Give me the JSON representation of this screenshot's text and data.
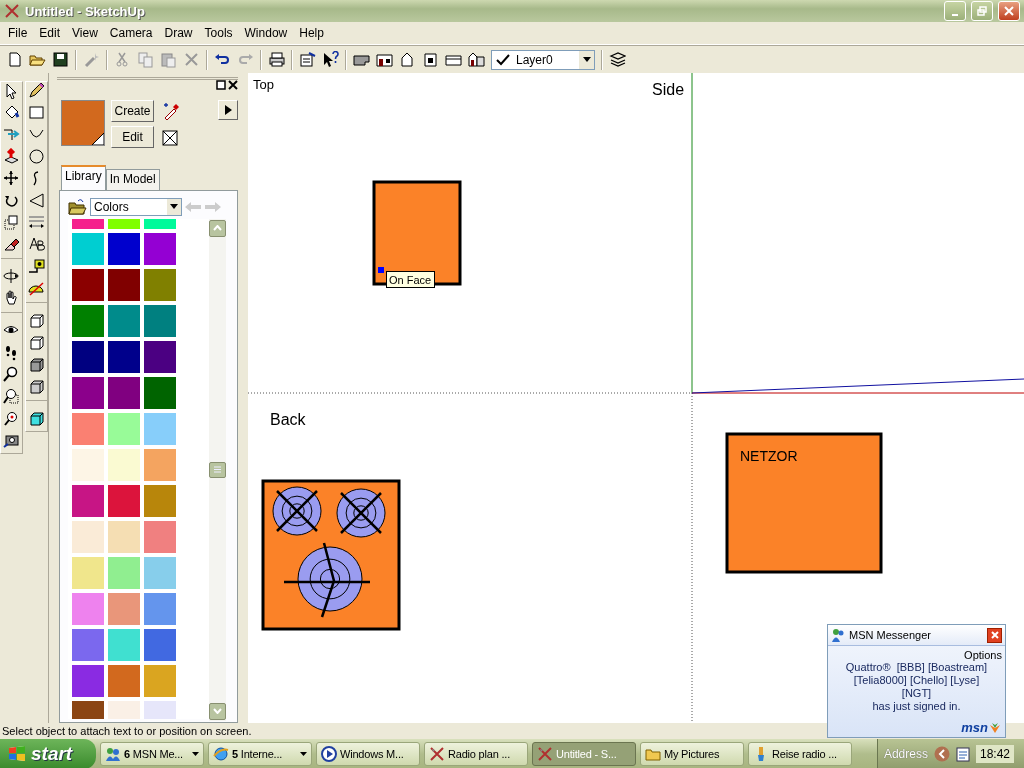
{
  "window": {
    "title": "Untitled - SketchUp"
  },
  "menu": [
    "File",
    "Edit",
    "View",
    "Camera",
    "Draw",
    "Tools",
    "Window",
    "Help"
  ],
  "layer_dropdown": {
    "value": "Layer0"
  },
  "materials": {
    "buttons": [
      "Create",
      "Edit"
    ],
    "tabs": [
      {
        "label": "Library",
        "selected": true
      },
      {
        "label": "In Model",
        "selected": false
      }
    ],
    "library": {
      "value": "Colors"
    },
    "swatch_rows": [
      [
        {
          "color": "#f5208c"
        },
        {
          "color": "#80ff00"
        },
        {
          "color": "#00fa9a"
        }
      ],
      [
        {
          "color": "#00ced1"
        },
        {
          "color": "#0000cd"
        },
        {
          "color": "#9400d3"
        }
      ],
      [
        {
          "color": "#8b0000"
        },
        {
          "color": "#800000"
        },
        {
          "color": "#808000"
        }
      ],
      [
        {
          "color": "#008000"
        },
        {
          "color": "#008b8b"
        },
        {
          "color": "#008080"
        }
      ],
      [
        {
          "color": "#000080"
        },
        {
          "color": "#00008b"
        },
        {
          "color": "#4b0082"
        }
      ],
      [
        {
          "color": "#8b008b"
        },
        {
          "color": "#800080"
        },
        {
          "color": "#006400"
        }
      ],
      [
        {
          "color": "#fa8072"
        },
        {
          "color": "#98fb98"
        },
        {
          "color": "#87cefa"
        }
      ],
      [
        {
          "color": "#fdf5e6"
        },
        {
          "color": "#fafad2"
        },
        {
          "color": "#f4a460"
        }
      ],
      [
        {
          "color": "#c71585"
        },
        {
          "color": "#dc143c"
        },
        {
          "color": "#b8860b"
        }
      ],
      [
        {
          "color": "#faebd7"
        },
        {
          "color": "#f5deb3"
        },
        {
          "color": "#f08080"
        }
      ],
      [
        {
          "color": "#f0e68c"
        },
        {
          "color": "#90ee90"
        },
        {
          "color": "#87ceeb"
        }
      ],
      [
        {
          "color": "#ee82ee"
        },
        {
          "color": "#e9967a"
        },
        {
          "color": "#6495ed"
        }
      ],
      [
        {
          "color": "#7b68ee"
        },
        {
          "color": "#40e0d0"
        },
        {
          "color": "#4169e1"
        }
      ],
      [
        {
          "color": "#8a2be2"
        },
        {
          "color": "#d2691e"
        },
        {
          "color": "#daa520"
        }
      ],
      [
        {
          "color": "#8b4513"
        },
        {
          "color": "#faf0e6"
        },
        {
          "color": "#e6e6fa"
        }
      ]
    ]
  },
  "viewport": {
    "top_label": "Top",
    "side_label": "Side",
    "back_label": "Back",
    "tooltip": "On Face",
    "netzor_label": "NETZOR"
  },
  "status_bar": "Select object to attach text to or position on screen.",
  "notification": {
    "title": "MSN Messenger",
    "options": "Options",
    "lines": [
      "Quattro®  [BBB] [Boastream]",
      "[Telia8000] [Chello] [Lyse]",
      "[NGT]",
      "has just signed in."
    ],
    "logo": "msn"
  },
  "taskbar": {
    "start": "start",
    "items": [
      {
        "label": "**6** MSN Me...",
        "kind": "msn",
        "grouped": true,
        "selected": false
      },
      {
        "label": "**5** Interne...",
        "kind": "browser",
        "grouped": true,
        "selected": false
      },
      {
        "label": "Windows M...",
        "kind": "media",
        "grouped": false,
        "selected": false
      },
      {
        "label": "Radio plan ...",
        "kind": "sketchup",
        "grouped": false,
        "selected": false
      },
      {
        "label": "Untitled - S...",
        "kind": "sketchup",
        "grouped": false,
        "selected": true
      },
      {
        "label": "My Pictures",
        "kind": "folder",
        "grouped": false,
        "selected": false
      },
      {
        "label": "Reise radio ...",
        "kind": "paint",
        "grouped": false,
        "selected": false
      }
    ],
    "address": "Address",
    "clock": "18:42"
  }
}
